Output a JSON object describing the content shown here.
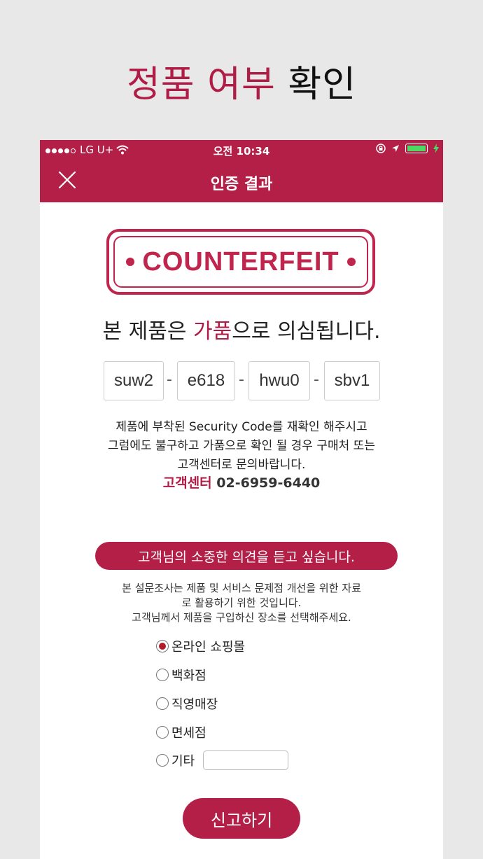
{
  "headline": {
    "accent": "정품 여부",
    "plain": "확인"
  },
  "statusbar": {
    "carrier": "LG U+",
    "time": "오전 10:34"
  },
  "navbar": {
    "title": "인증 결과"
  },
  "stamp": {
    "text": "COUNTERFEIT"
  },
  "verdict": {
    "prefix": "본 제품은 ",
    "highlight": "가품",
    "suffix": "으로 의심됩니다."
  },
  "codes": [
    "suw2",
    "e618",
    "hwu0",
    "sbv1"
  ],
  "code_separator": "-",
  "notice": {
    "line1": "제품에 부착된 Security Code를 재확인 해주시고",
    "line2": "그럼에도 불구하고 가품으로 확인 될 경우 구매처 또는",
    "line3": "고객센터로 문의바랍니다."
  },
  "support": {
    "label": "고객센터",
    "phone": "02-6959-6440"
  },
  "survey": {
    "title": "고객님의 소중한 의견을 듣고 싶습니다.",
    "desc1": "본 설문조사는 제품 및 서비스 문제점 개선을 위한 자료",
    "desc2": "로 활용하기 위한 것입니다.",
    "desc3": "고객님께서 제품을 구입하신 장소를 선택해주세요.",
    "options": [
      "온라인 쇼핑몰",
      "백화점",
      "직영매장",
      "면세점",
      "기타"
    ],
    "selected_index": 0
  },
  "report_button": "신고하기",
  "colors": {
    "brand": "#b41f47",
    "accent_text": "#b01c46"
  }
}
